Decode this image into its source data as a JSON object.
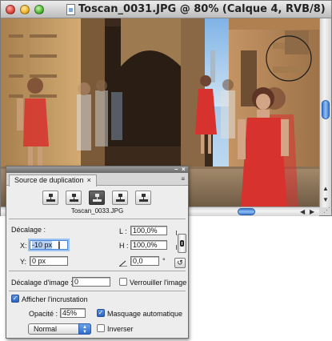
{
  "window": {
    "title": "Toscan_0031.JPG @ 80% (Calque 4, RVB/8)"
  },
  "panel": {
    "tab_label": "Source de duplication",
    "tab_close": "×",
    "menu_icon": "≡",
    "source_buttons": 5,
    "active_source": 3,
    "source_filename": "Toscan_0033.JPG",
    "offset_section_label": "Décalage :",
    "x_label": "X:",
    "x_value": "-10 px",
    "y_label": "Y:",
    "y_value": "0 px",
    "w_label": "L :",
    "w_value": "100,0%",
    "h_label": "H :",
    "h_value": "100,0%",
    "angle_value": "0,0",
    "angle_unit": "°",
    "frame_offset_label": "Décalage d'image :",
    "frame_offset_value": "0",
    "lock_frame_label": "Verrouiller l'image",
    "lock_frame_checked": false,
    "show_overlay_label": "Afficher l'incrustation",
    "show_overlay_checked": true,
    "opacity_label": "Opacité :",
    "opacity_value": "45%",
    "auto_hide_label": "Masquage automatique",
    "auto_hide_checked": true,
    "blend_mode": "Normal",
    "invert_label": "Inverser",
    "invert_checked": false
  },
  "colors": {
    "accent_blue": "#2f6ccb",
    "focus_ring": "#9cc2f2",
    "dress_red": "#d8322e"
  }
}
